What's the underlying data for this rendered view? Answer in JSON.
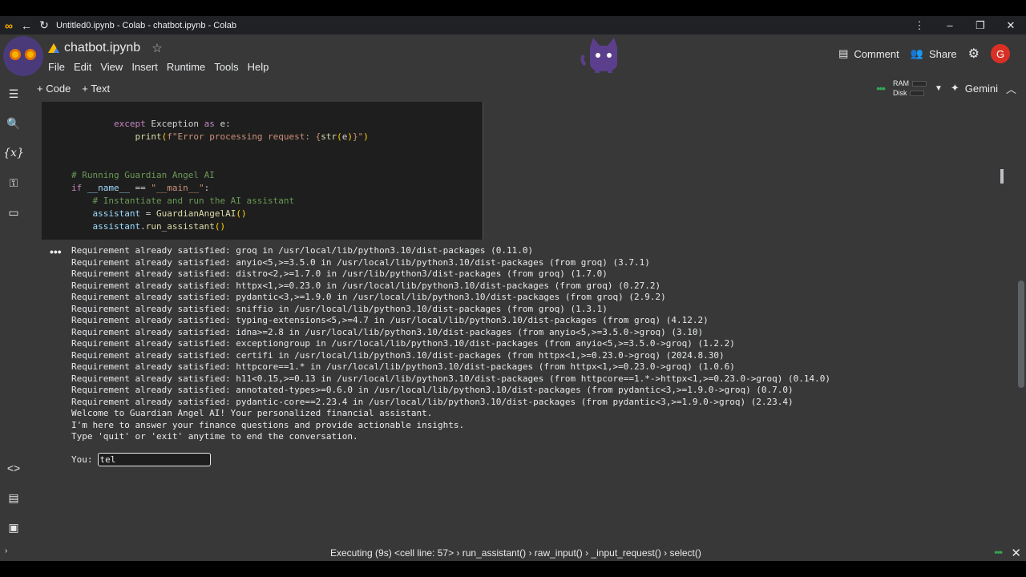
{
  "browser": {
    "title": "Untitled0.ipynb - Colab - chatbot.ipynb - Colab"
  },
  "notebook": {
    "name": "chatbot.ipynb"
  },
  "menu": [
    "File",
    "Edit",
    "View",
    "Insert",
    "Runtime",
    "Tools",
    "Help"
  ],
  "header": {
    "comment": "Comment",
    "share": "Share",
    "avatar": "G"
  },
  "toolbar": {
    "code": "+ Code",
    "text": "+ Text",
    "ram": "RAM",
    "disk": "Disk",
    "gemini": "Gemini"
  },
  "code_lines": [
    "        except Exception as e:",
    "            print(f\"Error processing request: {str(e)}\")",
    "",
    "",
    "# Running Guardian Angel AI",
    "if __name__ == \"__main__\":",
    "    # Instantiate and run the AI assistant",
    "    assistant = GuardianAngelAI()",
    "    assistant.run_assistant()"
  ],
  "output_lines": [
    "Requirement already satisfied: groq in /usr/local/lib/python3.10/dist-packages (0.11.0)",
    "Requirement already satisfied: anyio<5,>=3.5.0 in /usr/local/lib/python3.10/dist-packages (from groq) (3.7.1)",
    "Requirement already satisfied: distro<2,>=1.7.0 in /usr/lib/python3/dist-packages (from groq) (1.7.0)",
    "Requirement already satisfied: httpx<1,>=0.23.0 in /usr/local/lib/python3.10/dist-packages (from groq) (0.27.2)",
    "Requirement already satisfied: pydantic<3,>=1.9.0 in /usr/local/lib/python3.10/dist-packages (from groq) (2.9.2)",
    "Requirement already satisfied: sniffio in /usr/local/lib/python3.10/dist-packages (from groq) (1.3.1)",
    "Requirement already satisfied: typing-extensions<5,>=4.7 in /usr/local/lib/python3.10/dist-packages (from groq) (4.12.2)",
    "Requirement already satisfied: idna>=2.8 in /usr/local/lib/python3.10/dist-packages (from anyio<5,>=3.5.0->groq) (3.10)",
    "Requirement already satisfied: exceptiongroup in /usr/local/lib/python3.10/dist-packages (from anyio<5,>=3.5.0->groq) (1.2.2)",
    "Requirement already satisfied: certifi in /usr/local/lib/python3.10/dist-packages (from httpx<1,>=0.23.0->groq) (2024.8.30)",
    "Requirement already satisfied: httpcore==1.* in /usr/local/lib/python3.10/dist-packages (from httpx<1,>=0.23.0->groq) (1.0.6)",
    "Requirement already satisfied: h11<0.15,>=0.13 in /usr/local/lib/python3.10/dist-packages (from httpcore==1.*->httpx<1,>=0.23.0->groq) (0.14.0)",
    "Requirement already satisfied: annotated-types>=0.6.0 in /usr/local/lib/python3.10/dist-packages (from pydantic<3,>=1.9.0->groq) (0.7.0)",
    "Requirement already satisfied: pydantic-core==2.23.4 in /usr/local/lib/python3.10/dist-packages (from pydantic<3,>=1.9.0->groq) (2.23.4)",
    "Welcome to Guardian Angel AI! Your personalized financial assistant.",
    "I'm here to answer your finance questions and provide actionable insights.",
    "Type 'quit' or 'exit' anytime to end the conversation."
  ],
  "prompt": {
    "label": "You:",
    "value": "tel"
  },
  "status": "Executing (9s)   <cell line: 57> › run_assistant() › raw_input() › _input_request() › select()"
}
